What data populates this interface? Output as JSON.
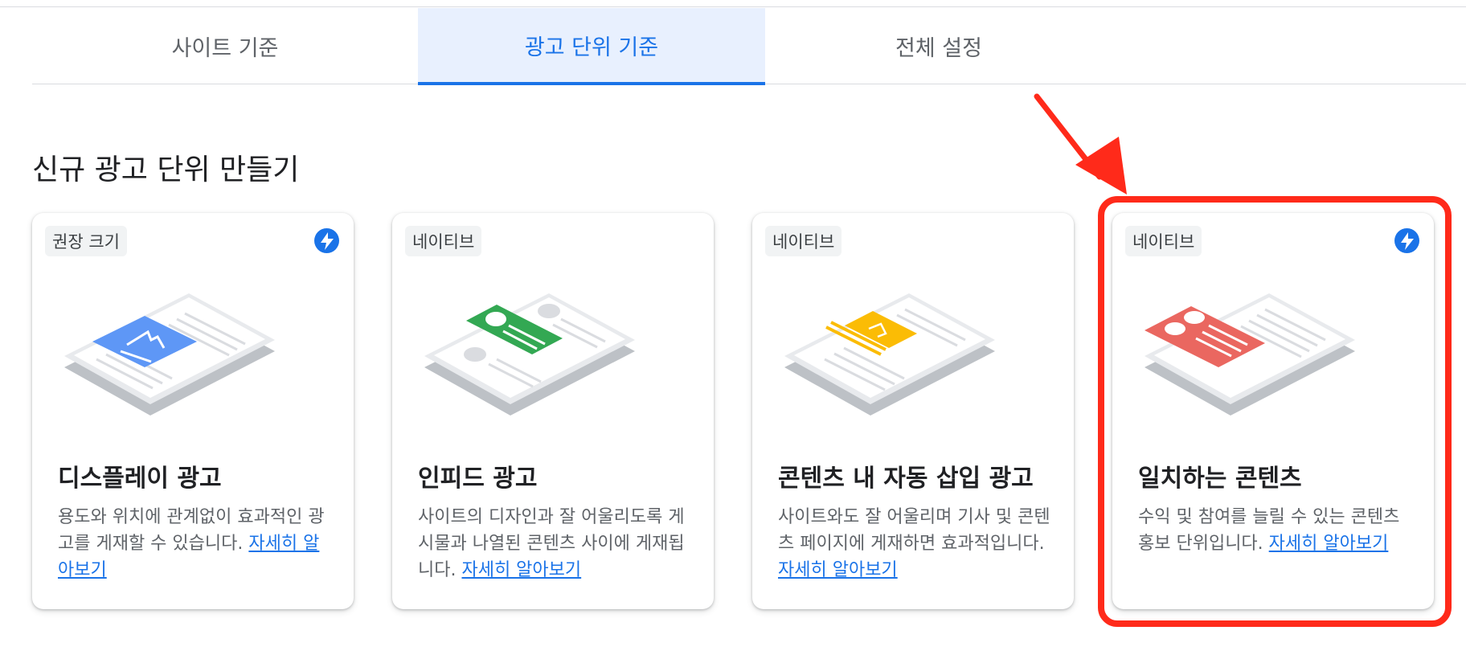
{
  "tabs": [
    {
      "label": "사이트 기준",
      "active": false
    },
    {
      "label": "광고 단위 기준",
      "active": true
    },
    {
      "label": "전체 설정",
      "active": false
    }
  ],
  "section_title": "신규 광고 단위 만들기",
  "learn_more": "자세히 알아보기",
  "cards": [
    {
      "chip": "권장 크기",
      "has_bolt": true,
      "title": "디스플레이 광고",
      "desc": "용도와 위치에 관계없이 효과적인 광고를 게재할 수 있습니다. ",
      "link": "자세히 알아보기",
      "accent": "#5e97f6"
    },
    {
      "chip": "네이티브",
      "has_bolt": false,
      "title": "인피드 광고",
      "desc": "사이트의 디자인과 잘 어울리도록 게시물과 나열된 콘텐츠 사이에 게재됩니다. ",
      "link": "자세히 알아보기",
      "accent": "#33a853"
    },
    {
      "chip": "네이티브",
      "has_bolt": false,
      "title": "콘텐츠 내 자동 삽입 광고",
      "desc": "사이트와도 잘 어울리며 기사 및 콘텐츠 페이지에 게재하면 효과적입니다. ",
      "link": "자세히 알아보기",
      "accent": "#fbbc05"
    },
    {
      "chip": "네이티브",
      "has_bolt": true,
      "title": "일치하는 콘텐츠",
      "desc": "수익 및 참여를 늘릴 수 있는 콘텐츠 홍보 단위입니다. ",
      "link": "자세히 알아보기",
      "accent": "#ea6760"
    }
  ],
  "annotation_color": "#ff2a1a",
  "icons": {
    "bolt": "lightning-bolt-icon",
    "arrow": "red-arrow-annotation"
  }
}
